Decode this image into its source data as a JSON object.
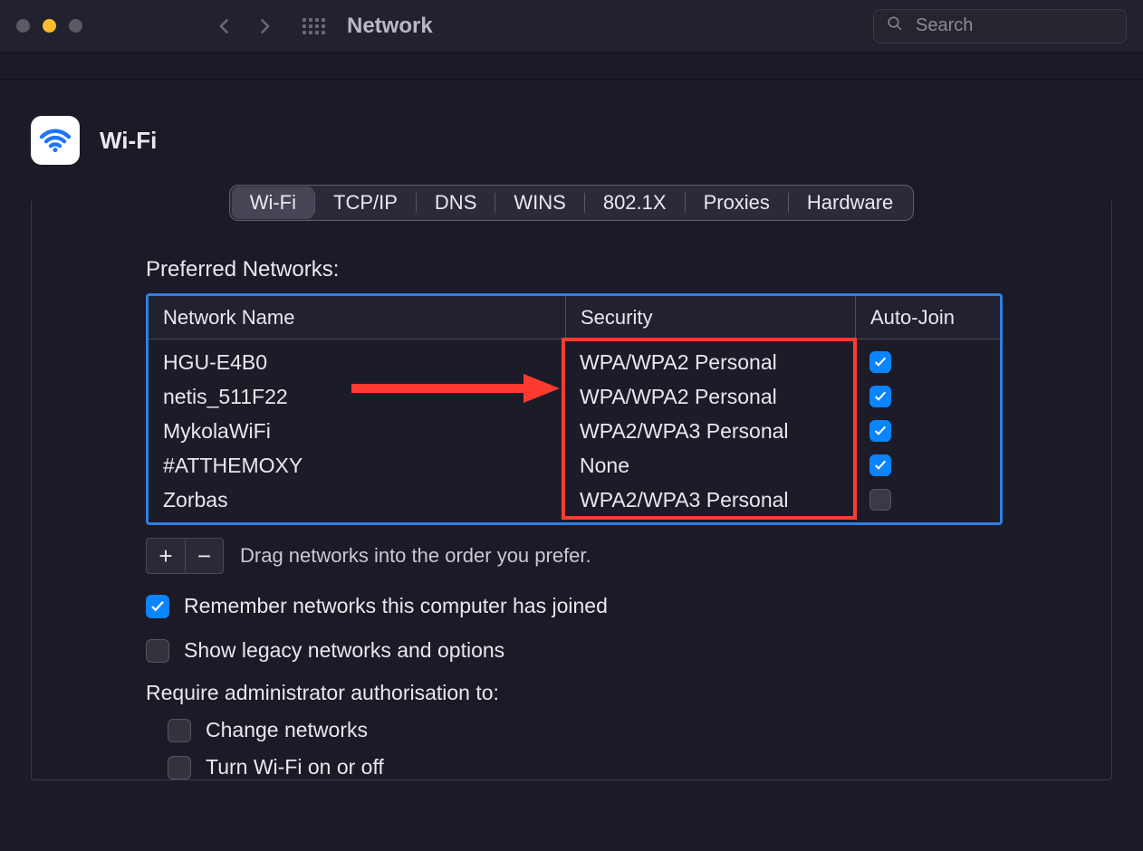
{
  "window_title": "Network",
  "search": {
    "placeholder": "Search"
  },
  "page": {
    "title": "Wi-Fi"
  },
  "tabs": [
    "Wi-Fi",
    "TCP/IP",
    "DNS",
    "WINS",
    "802.1X",
    "Proxies",
    "Hardware"
  ],
  "active_tab_index": 0,
  "preferred_label": "Preferred Networks:",
  "table": {
    "columns": [
      "Network Name",
      "Security",
      "Auto-Join"
    ],
    "rows": [
      {
        "name": "HGU-E4B0",
        "security": "WPA/WPA2 Personal",
        "auto_join": true
      },
      {
        "name": "netis_511F22",
        "security": "WPA/WPA2 Personal",
        "auto_join": true
      },
      {
        "name": "MykolaWiFi",
        "security": "WPA2/WPA3 Personal",
        "auto_join": true
      },
      {
        "name": "#ATTHEMOXY",
        "security": "None",
        "auto_join": true
      },
      {
        "name": "Zorbas",
        "security": "WPA2/WPA3 Personal",
        "auto_join": false
      }
    ]
  },
  "buttons": {
    "add": "+",
    "remove": "−"
  },
  "drag_hint": "Drag networks into the order you prefer.",
  "options": {
    "remember": {
      "label": "Remember networks this computer has joined",
      "checked": true
    },
    "legacy": {
      "label": "Show legacy networks and options",
      "checked": false
    }
  },
  "auth": {
    "label": "Require administrator authorisation to:",
    "change": {
      "label": "Change networks",
      "checked": false
    },
    "toggle": {
      "label": "Turn Wi-Fi on or off",
      "checked": false
    }
  }
}
